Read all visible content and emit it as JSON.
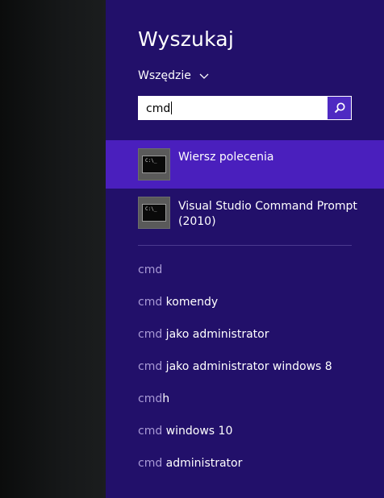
{
  "search_panel": {
    "title": "Wyszukaj",
    "scope_label": "Wszędzie",
    "search_value": "cmd",
    "accent_color": "#4a1fbd",
    "background_color": "#22106a"
  },
  "results": [
    {
      "label": "Wiersz polecenia",
      "icon": "command-prompt-icon",
      "icon_text": "C:\\_",
      "selected": true
    },
    {
      "label": "Visual Studio Command Prompt (2010)",
      "icon": "command-prompt-icon",
      "icon_text": "C:\\_",
      "selected": false
    }
  ],
  "suggestions": [
    {
      "query": "cmd",
      "rest": ""
    },
    {
      "query": "cmd",
      "rest": " komendy"
    },
    {
      "query": "cmd",
      "rest": " jako administrator"
    },
    {
      "query": "cmd",
      "rest": " jako administrator windows 8"
    },
    {
      "query": "cmd",
      "rest": "h"
    },
    {
      "query": "cmd",
      "rest": " windows 10"
    },
    {
      "query": "cmd",
      "rest": " administrator"
    }
  ]
}
